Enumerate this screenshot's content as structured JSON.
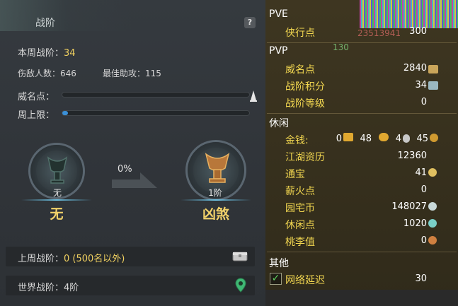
{
  "panel": {
    "title": "战阶",
    "help": "?",
    "week_rank_label": "本周战阶：",
    "week_rank_value": "34",
    "kills_label": "伤敌人数：",
    "kills_value": "646",
    "assist_label": "最佳助攻：",
    "assist_value": "115",
    "prestige_label": "威名点：",
    "prestige_progress": 0,
    "cap_label": "周上限：",
    "cap_progress": 0.02,
    "current_medal_small": "无",
    "current_medal_big": "无",
    "progress_percent": "0%",
    "next_medal_small": "1阶",
    "next_medal_big": "凶煞",
    "last_week_label": "上周战阶：",
    "last_week_value": "0 (500名以外)",
    "world_rank_label": "世界战阶：",
    "world_rank_value": "4阶"
  },
  "stats": {
    "pve_header": "PVE",
    "pve_rows": [
      {
        "label": "侠行点",
        "value": "300"
      }
    ],
    "pvp_header": "PVP",
    "pvp_rows": [
      {
        "label": "威名点",
        "value": "2840"
      },
      {
        "label": "战阶积分",
        "value": "34"
      },
      {
        "label": "战阶等级",
        "value": "0"
      }
    ],
    "leisure_header": "休闲",
    "money_label": "金钱:",
    "money_gold": "0",
    "money_silver": "48",
    "money_copper": "4",
    "money_other": "45",
    "leisure_rows": [
      {
        "label": "江湖资历",
        "value": "12360"
      },
      {
        "label": "通宝",
        "value": "41"
      },
      {
        "label": "薪火点",
        "value": "0"
      },
      {
        "label": "园宅币",
        "value": "148027"
      },
      {
        "label": "休闲点",
        "value": "1020"
      },
      {
        "label": "桃李值",
        "value": "0"
      }
    ],
    "other_header": "其他",
    "latency_label": "网络延迟",
    "latency_value": "30",
    "bg_numbers": "23513941",
    "bg_130": "130"
  },
  "colors": {
    "gold_text": "#f2d750",
    "highlight": "#f0d060",
    "bar_fill": "#3b8fd6"
  }
}
